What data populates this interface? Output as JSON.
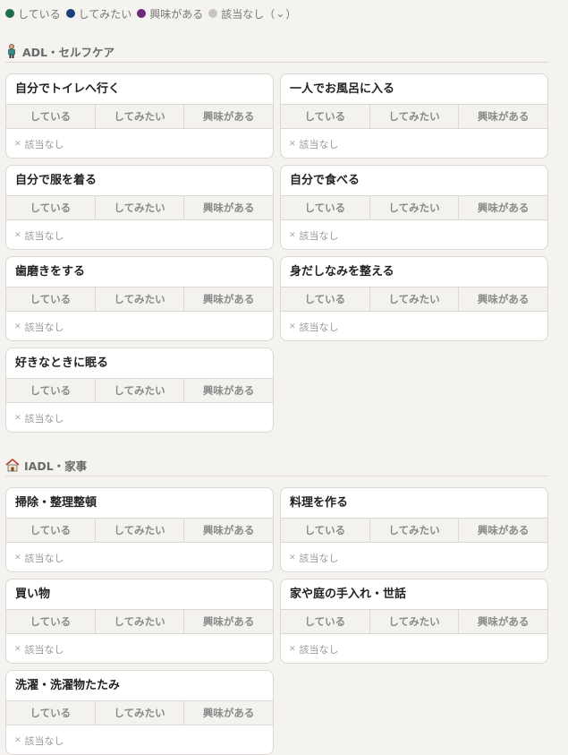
{
  "legend": {
    "items": [
      {
        "label": "している",
        "color": "#1f6b4e"
      },
      {
        "label": "してみたい",
        "color": "#1d3f7a"
      },
      {
        "label": "興味がある",
        "color": "#6b2a78"
      },
      {
        "label": "該当なし（",
        "color": "#c8c5bf"
      }
    ],
    "suffix_icon": "⌄",
    "suffix_close": "）"
  },
  "option_labels": {
    "doing": "している",
    "want": "してみたい",
    "interested": "興味がある",
    "na": "該当なし",
    "na_icon": "✕"
  },
  "sections": [
    {
      "title": "ADL・セルフケア",
      "icon": "person-icon",
      "cards": [
        {
          "title": "自分でトイレへ行く"
        },
        {
          "title": "一人でお風呂に入る"
        },
        {
          "title": "自分で服を着る"
        },
        {
          "title": "自分で食べる"
        },
        {
          "title": "歯磨きをする"
        },
        {
          "title": "身だしなみを整える"
        },
        {
          "title": "好きなときに眠る"
        }
      ]
    },
    {
      "title": "IADL・家事",
      "icon": "house-icon",
      "cards": [
        {
          "title": "掃除・整理整頓"
        },
        {
          "title": "料理を作る"
        },
        {
          "title": "買い物"
        },
        {
          "title": "家や庭の手入れ・世話"
        },
        {
          "title": "洗濯・洗濯物たたみ"
        }
      ]
    }
  ]
}
